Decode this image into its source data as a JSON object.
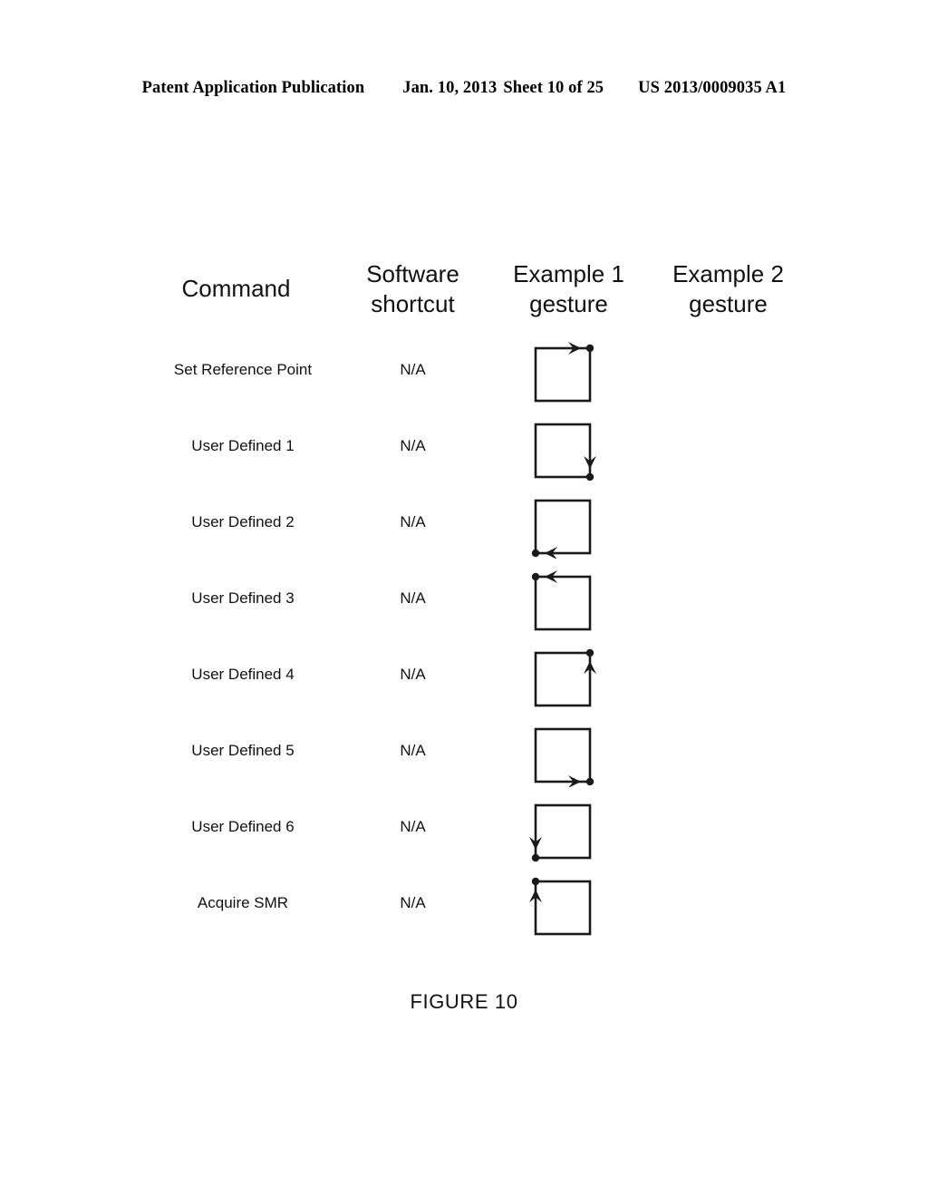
{
  "patent_header": {
    "publication": "Patent Application Publication",
    "date": "Jan. 10, 2013",
    "sheet": "Sheet 10 of 25",
    "number": "US 2013/0009035 A1"
  },
  "figure": {
    "caption": "FIGURE 10",
    "stroke_color": "#1a1a1a"
  },
  "table": {
    "columns": [
      {
        "id": "command",
        "label": "Command"
      },
      {
        "id": "shortcut",
        "label": "Software\nshortcut"
      },
      {
        "id": "example1",
        "label": "Example 1\ngesture"
      },
      {
        "id": "example2",
        "label": "Example 2\ngesture"
      }
    ],
    "headers": {
      "command": "Command",
      "shortcut_line1": "Software",
      "shortcut_line2": "shortcut",
      "example1_line1": "Example 1",
      "example1_line2": "gesture",
      "example2_line1": "Example 2",
      "example2_line2": "gesture"
    },
    "rows": [
      {
        "command": "Set Reference Point",
        "shortcut": "N/A",
        "gesture1": {
          "shape": "square",
          "arrow_edge": "top",
          "arrow_direction": "right",
          "dot_corner": "top-right",
          "open_edge": "none"
        },
        "gesture2": null
      },
      {
        "command": "User Defined 1",
        "shortcut": "N/A",
        "gesture1": {
          "shape": "square",
          "arrow_edge": "right",
          "arrow_direction": "down",
          "dot_corner": "bottom-right",
          "open_edge": "none"
        },
        "gesture2": null
      },
      {
        "command": "User Defined 2",
        "shortcut": "N/A",
        "gesture1": {
          "shape": "square",
          "arrow_edge": "bottom",
          "arrow_direction": "left",
          "dot_corner": "bottom-left",
          "open_edge": "none"
        },
        "gesture2": null
      },
      {
        "command": "User Defined 3",
        "shortcut": "N/A",
        "gesture1": {
          "shape": "square",
          "arrow_edge": "top",
          "arrow_direction": "left",
          "dot_corner": "top-left",
          "open_edge": "none"
        },
        "gesture2": null
      },
      {
        "command": "User Defined 4",
        "shortcut": "N/A",
        "gesture1": {
          "shape": "square",
          "arrow_edge": "right",
          "arrow_direction": "up",
          "dot_corner": "top-right",
          "open_edge": "none"
        },
        "gesture2": null
      },
      {
        "command": "User Defined 5",
        "shortcut": "N/A",
        "gesture1": {
          "shape": "square",
          "arrow_edge": "bottom",
          "arrow_direction": "right",
          "dot_corner": "bottom-right",
          "open_edge": "none"
        },
        "gesture2": null
      },
      {
        "command": "User Defined 6",
        "shortcut": "N/A",
        "gesture1": {
          "shape": "square",
          "arrow_edge": "left",
          "arrow_direction": "down",
          "dot_corner": "bottom-left",
          "open_edge": "none"
        },
        "gesture2": null
      },
      {
        "command": "Acquire SMR",
        "shortcut": "N/A",
        "gesture1": {
          "shape": "square",
          "arrow_edge": "left",
          "arrow_direction": "up",
          "dot_corner": "top-left",
          "open_edge": "none"
        },
        "gesture2": null
      }
    ]
  }
}
